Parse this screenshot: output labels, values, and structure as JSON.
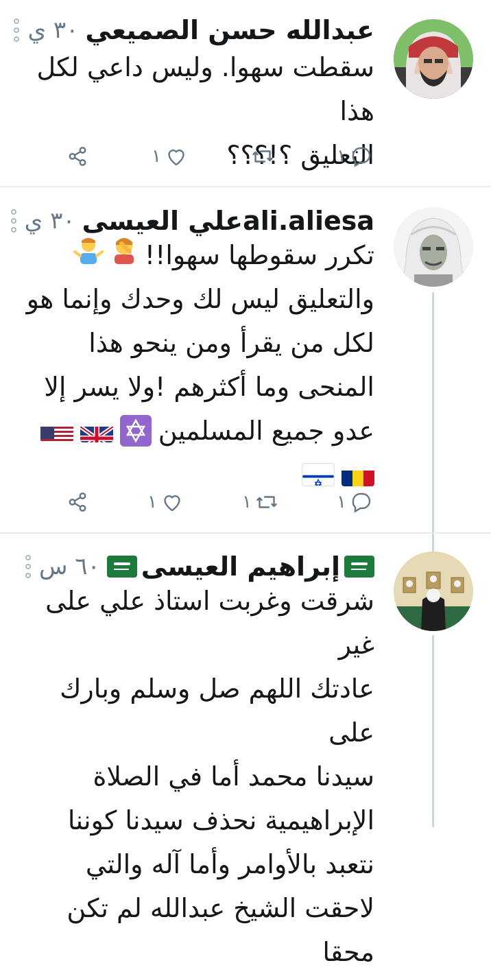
{
  "tweets": [
    {
      "name": "عبدالله حسن الصميعي",
      "time": "٣٠ ي",
      "text_lines": [
        "سقطت سهوا. وليس داعي لكل هذا",
        "التعليق ؟!؟؟؟"
      ],
      "reply_count": "١",
      "like_count": "١"
    },
    {
      "name": "علي العيسىali.aliesa",
      "time": "٣٠ ي",
      "text_lines": [
        "تكرر سقوطها سهوا!!",
        "والتعليق ليس لك وحدك وإنما هو",
        "لكل من يقرأ ومن ينحو هذا",
        "المنحى وما أكثرهم !ولا يسر إلا",
        "عدو جميع المسلمين"
      ],
      "reply_count": "١",
      "retweet_count": "١",
      "like_count": "١"
    },
    {
      "name": "إبراهيم العيسى",
      "time": "٦٠ س",
      "text_lines": [
        "شرقت وغربت استاذ علي على غير",
        "عادتك اللهم صل وسلم وبارك على",
        "سيدنا محمد أما في الصلاة",
        "الإبراهيمية نحذف سيدنا كوننا",
        "نتعبد بالأوامر وأما آله والتي",
        "لاحقت الشيخ عبدالله لم تكن محقا"
      ]
    }
  ],
  "colors": {
    "text": "#14171a",
    "muted": "#657786",
    "thread": "#ccd6dd",
    "flag_green": "#1c7a3d"
  }
}
